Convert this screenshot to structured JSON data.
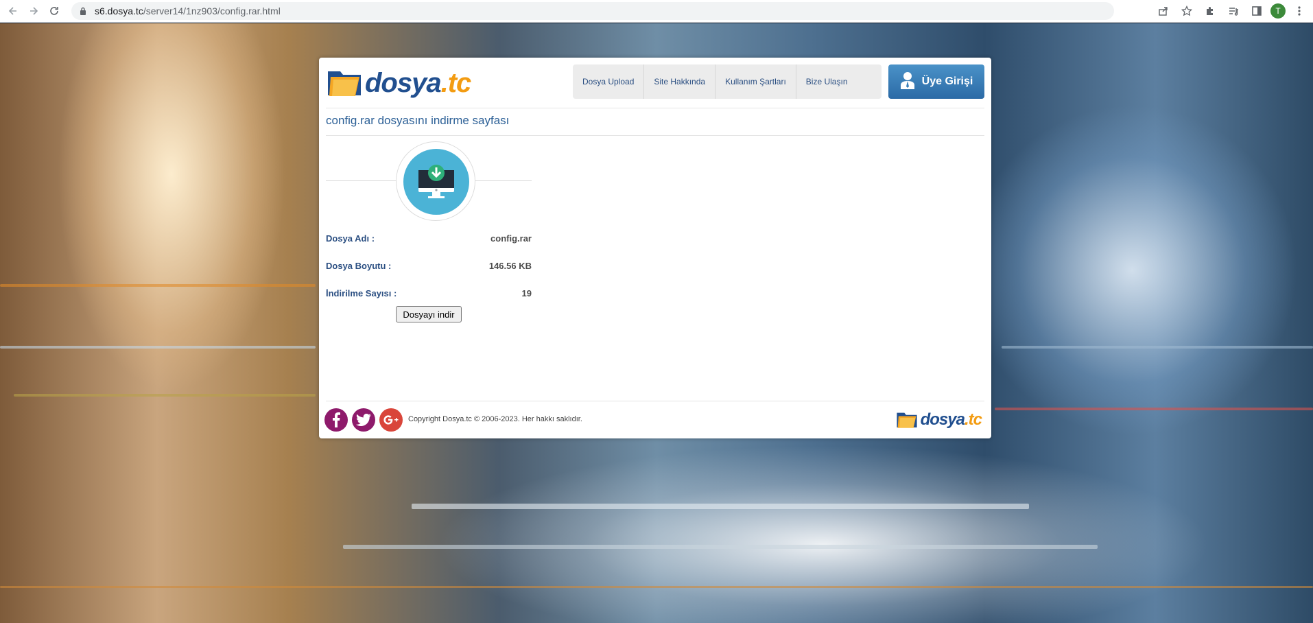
{
  "browser": {
    "url_host": "s6.dosya.tc",
    "url_path": "/server14/1nz903/config.rar.html",
    "profile_initial": "T"
  },
  "site": {
    "logo_name": "dosya",
    "logo_tld": ".tc",
    "nav": [
      "Dosya Upload",
      "Site Hakkında",
      "Kullanım Şartları",
      "Bize Ulaşın"
    ],
    "login_label": "Üye Girişi"
  },
  "page": {
    "title": "config.rar dosyasını indirme sayfası",
    "file_name_label": "Dosya Adı :",
    "file_name": "config.rar",
    "file_size_label": "Dosya Boyutu :",
    "file_size": "146.56 KB",
    "download_count_label": "İndirilme Sayısı :",
    "download_count": "19",
    "download_button": "Dosyayı indir"
  },
  "footer": {
    "copyright": "Copyright Dosya.tc © 2006-2023. Her hakkı saklıdır."
  },
  "colors": {
    "accent": "#2b5f96",
    "login_button": "#3a80ba",
    "facebook": "#8e1a6b",
    "twitter": "#8e1a6b",
    "googleplus": "#d9453a"
  },
  "icons": [
    "back-icon",
    "forward-icon",
    "reload-icon",
    "lock-icon",
    "share-icon",
    "star-icon",
    "extensions-icon",
    "reading-list-icon",
    "side-panel-icon",
    "menu-icon",
    "user-icon",
    "download-monitor-icon",
    "facebook-icon",
    "twitter-icon",
    "google-plus-icon"
  ]
}
